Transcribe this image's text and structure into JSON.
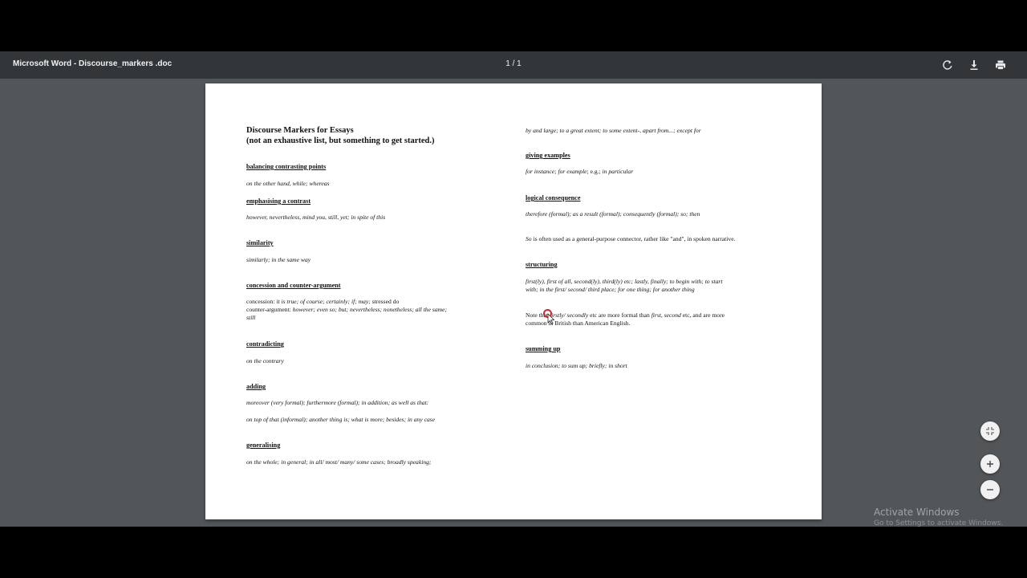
{
  "toolbar": {
    "title": "Microsoft Word - Discourse_markers .doc",
    "page_indicator": "1 / 1",
    "rotate_icon": "rotate-icon",
    "download_icon": "download-icon",
    "print_icon": "print-icon"
  },
  "document": {
    "title_line1": "Discourse Markers for Essays",
    "title_line2": "(not an exhaustive list, but something to get started.)",
    "left": {
      "balancing_heading": "balancing contrasting points",
      "balancing_text": "on the other hand, while; whereas",
      "emphasising_heading": "emphasising a contrast",
      "emphasising_text": "however, nevertheless,  mind you, still, yet;  in spite of this",
      "similarity_heading": "similarity",
      "similarity_text": "similarly; in the same way",
      "concession_heading": "concession and counter-argument",
      "concession_label": "concession:",
      "concession_text": " it is true; of course; certainly; if; may;",
      "concession_tail": " stressed do",
      "counter_label": "counter-argument:",
      "counter_text": " however; even so; but; nevertheless; nonetheless; all the same;",
      "counter_text2": "still",
      "contradicting_heading": "contradicting",
      "contradicting_text": "on the contrary",
      "adding_heading": "adding",
      "adding_text1": "moreover (very formal); furthermore (formal); in addition; as well as that:",
      "adding_text2": "on top of that (informal); another thing is; what is more; besides; in any case",
      "generalising_heading": "generalising",
      "generalising_text": "on the whole; in general; in all/ most/ many/ some cases; broadly speaking;"
    },
    "right": {
      "generalising_cont": "by and large; to a great extent; to some extent-, apart from...; except for",
      "examples_heading": "giving examples",
      "examples_a": "for instance; for example",
      "examples_b": "; e.g.; ",
      "examples_c": "in particular",
      "logical_heading": "logical consequence",
      "logical_text": "therefore (formal); as a result (formal); consequently (formal); so; then",
      "so_word": "So",
      "so_text": " is often used as a general-purpose connector, rather like \"and\", in spoken narrative.",
      "structuring_heading": "structuring",
      "structuring_text1": "first(ly), first of all, second(ly), third(ly) etc; lastly, finally; to begin with; to start",
      "structuring_text2": "with; in the first/ second/ third place; for one thing; for another thing",
      "note_a": "Note that ",
      "note_b": "firstly/ secondly",
      "note_c": " etc are more formal than ",
      "note_d": "first, second",
      "note_e": " etc, and are more",
      "note_line2": "common in British than American English.",
      "summing_heading": "summing up",
      "summing_text": "in conclusion; to sum up; briefly; in short"
    }
  },
  "controls": {
    "fit_icon": "fit-to-page-icon",
    "zoom_in_icon": "zoom-in-icon",
    "zoom_out_icon": "zoom-out-icon"
  },
  "watermark": {
    "line1": "Activate Windows",
    "line2": "Go to Settings to activate Windows."
  },
  "colors": {
    "toolbar_bg": "#323639",
    "viewer_bg": "#525659",
    "cursor_ring": "#d9262c"
  }
}
